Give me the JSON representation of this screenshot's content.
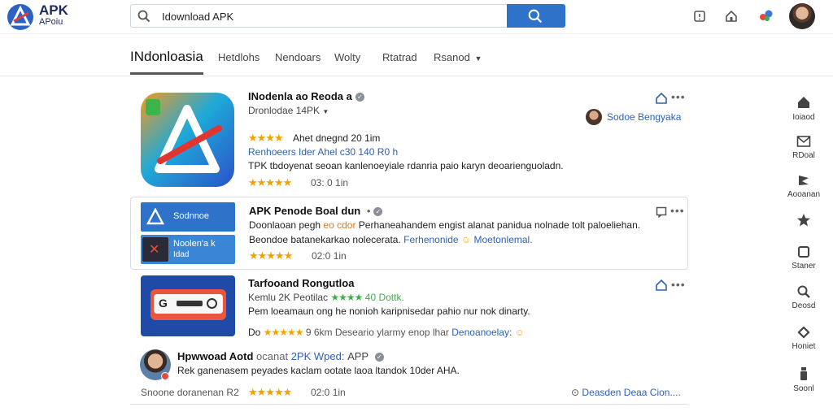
{
  "header": {
    "logo_line1": "APK",
    "logo_line2": "APoiu",
    "search_value": "Idownload APK"
  },
  "tabs": [
    {
      "label": "INdonloasia"
    },
    {
      "label": "Hetdlohs"
    },
    {
      "label": "Nendoars"
    },
    {
      "label": "Wolty"
    },
    {
      "label": "Rtatrad"
    },
    {
      "label": "Rsanod"
    }
  ],
  "results": [
    {
      "title": "INodenla ao Reoda a",
      "subtitle": "Dronlodae 14PK",
      "rating_text": "Ahet dnegnd 20 1im",
      "blue_line": "Renhoeers Ider Ahel c30 140 R0 h",
      "description": "TPK tbdoyenat seoan kanlenoeyiale rdanria paio karyn deoarienguoladn.",
      "meta": "03: 0 1in",
      "author": "Sodoe Bengyaka"
    },
    {
      "title": "APK Penode Boal dun",
      "thumb_top": "Sodnnoe",
      "thumb_bottom_1": "Noolen'a k",
      "thumb_bottom_2": "Idad",
      "description_1": "Doonlaoan pegh",
      "description_orange": "eo cdor",
      "description_rest": "Perhaneahandem engist alanat panidua nolnade tolt paloeliehan.",
      "line2_text": "Beondoe batanekarkao nolecerata.",
      "line2_link": "Ferhenonide",
      "line2_tail": "Moetonlemal.",
      "meta": "02:0 1in"
    },
    {
      "title": "Tarfooand Rongutloa",
      "sub_prefix": "Kemlu 2K Peotilac",
      "sub_green": "40 Dottk.",
      "button_label": "G",
      "description": "Pem loeamaun ong he nonioh karipnisedar pahio nur nok dinarty.",
      "meta_prefix": "Do",
      "meta_mid": "9 6km Deseario ylarmy enop lhar",
      "meta_link": "Denoanoelay:"
    },
    {
      "title": "Hpwwoad Aotd",
      "title_tail_gray": "ocanat",
      "title_tail_blue": "2PK Wped:",
      "title_tail_app": "APP",
      "description": "Rek ganenasem peyades kaclam ootate laoa ltandok 10der AHA.",
      "footer_left": "Snoone doranenan R2",
      "meta": "02:0 1in",
      "footer_link": "Deasden Deaa Cion...."
    }
  ],
  "sidebar": [
    {
      "label": "Ioiaod",
      "icon": "home-icon"
    },
    {
      "label": "RDoal",
      "icon": "mail-icon"
    },
    {
      "label": "Aooanan",
      "icon": "flag-icon"
    },
    {
      "label": "",
      "icon": "star-icon"
    },
    {
      "label": "Staner",
      "icon": "square-icon"
    },
    {
      "label": "Deosd",
      "icon": "search-icon"
    },
    {
      "label": "Honiet",
      "icon": "diamond-icon"
    },
    {
      "label": "Soonl",
      "icon": "bottle-icon"
    }
  ],
  "colors": {
    "accent": "#2f72c9",
    "star": "#f2a200",
    "link": "#2b62b8"
  }
}
